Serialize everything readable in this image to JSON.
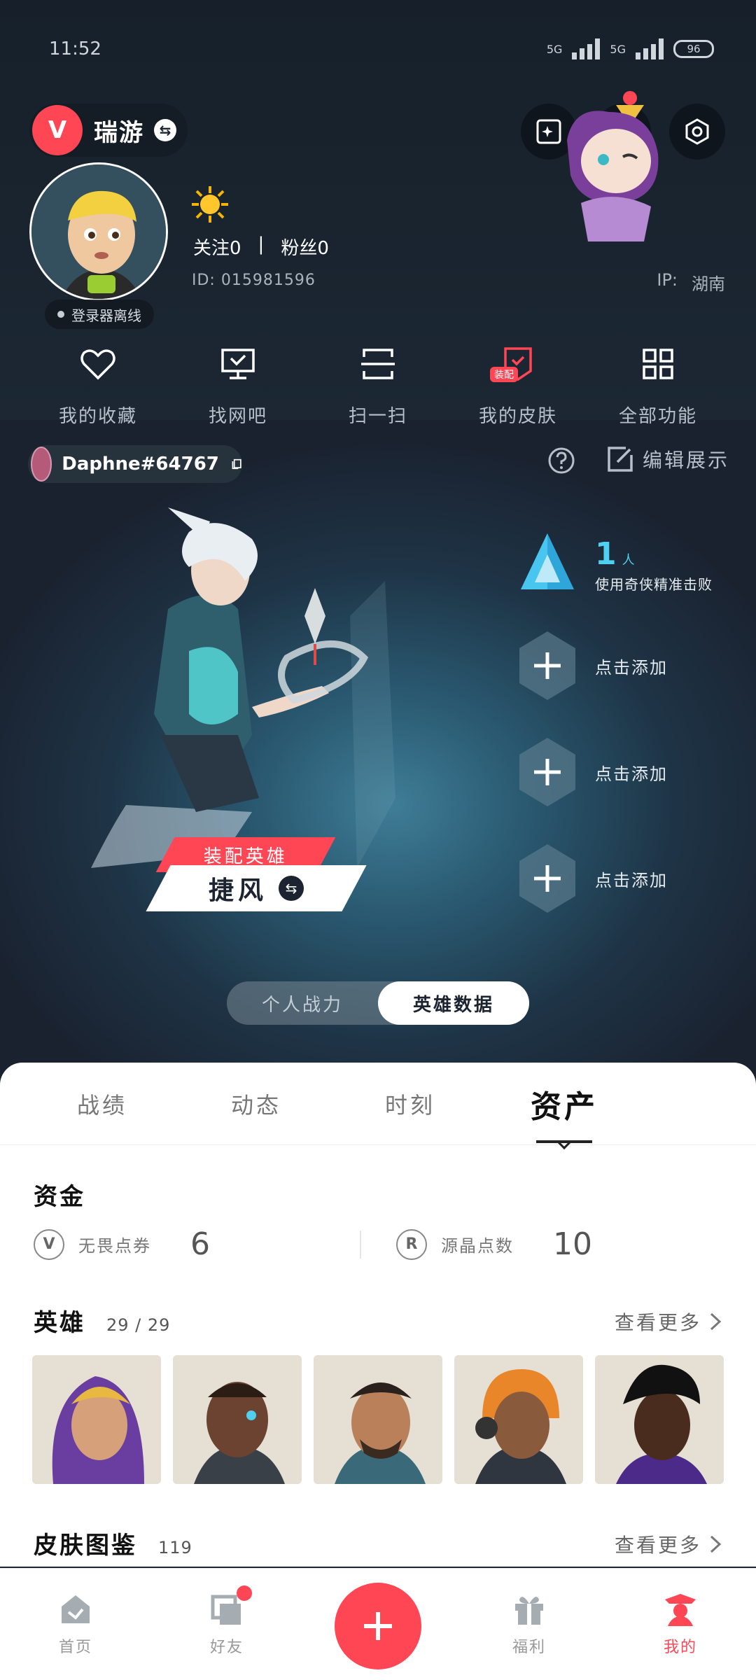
{
  "status_bar": {
    "time": "11:52",
    "network_left": "5G",
    "network_right": "5G",
    "battery": "96"
  },
  "header": {
    "game_name": "瑞游"
  },
  "profile": {
    "status": "登录器离线",
    "follow": "关注0",
    "separator": "|",
    "fans": "粉丝0",
    "id_label": "ID:",
    "id_value": "015981596",
    "ip_label": "IP:",
    "ip_value": "湖南"
  },
  "quick_actions": [
    {
      "label": "我的收藏",
      "icon": "heart-icon"
    },
    {
      "label": "找网吧",
      "icon": "monitor-icon"
    },
    {
      "label": "扫一扫",
      "icon": "scan-icon"
    },
    {
      "label": "我的皮肤",
      "icon": "skin-icon",
      "badge": "装配"
    },
    {
      "label": "全部功能",
      "icon": "grid-icon"
    }
  ],
  "riot": {
    "name": "Daphne#64767",
    "edit_label": "编辑展示"
  },
  "hero": {
    "equipped_label": "装配英雄",
    "agent_name": "捷风",
    "achievement": {
      "count": "1",
      "unit": "人",
      "desc": "使用奇侠精准击败"
    },
    "slots": [
      "点击添加",
      "点击添加",
      "点击添加"
    ]
  },
  "segment": {
    "left": "个人战力",
    "right": "英雄数据"
  },
  "tabs": [
    "战绩",
    "动态",
    "时刻",
    "资产"
  ],
  "assets": {
    "funds_title": "资金",
    "fund1_label": "无畏点券",
    "fund1_value": "6",
    "fund2_label": "源晶点数",
    "fund2_value": "10",
    "agents_title": "英雄",
    "agents_count": "29 / 29",
    "skins_title": "皮肤图鉴",
    "skins_count": "119",
    "more_label": "查看更多"
  },
  "bottom_nav": [
    "首页",
    "好友",
    "福利",
    "我的"
  ],
  "colors": {
    "accent": "#ff4655",
    "achievement": "#4fd0f0"
  }
}
